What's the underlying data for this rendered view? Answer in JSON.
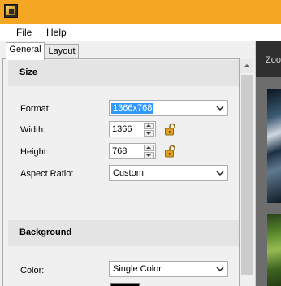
{
  "menu": {
    "file": "File",
    "help": "Help"
  },
  "tabs": {
    "general": "General",
    "layout": "Layout"
  },
  "size_section": {
    "title": "Size",
    "format_label": "Format:",
    "format_value": "1366x768",
    "width_label": "Width:",
    "width_value": "1366",
    "height_label": "Height:",
    "height_value": "768",
    "aspect_label": "Aspect Ratio:",
    "aspect_value": "Custom"
  },
  "background_section": {
    "title": "Background",
    "color_label": "Color:",
    "color_value": "Single Color",
    "swatch_color": "#000000"
  },
  "preview": {
    "zoom_label": "Zoo"
  },
  "colors": {
    "titlebar": "#f5a623",
    "selection": "#3399ff",
    "lock": "#e0a020"
  },
  "icons": {
    "app": "app-icon",
    "lock": "padlock-icon",
    "dropdown": "chevron-down-icon"
  }
}
